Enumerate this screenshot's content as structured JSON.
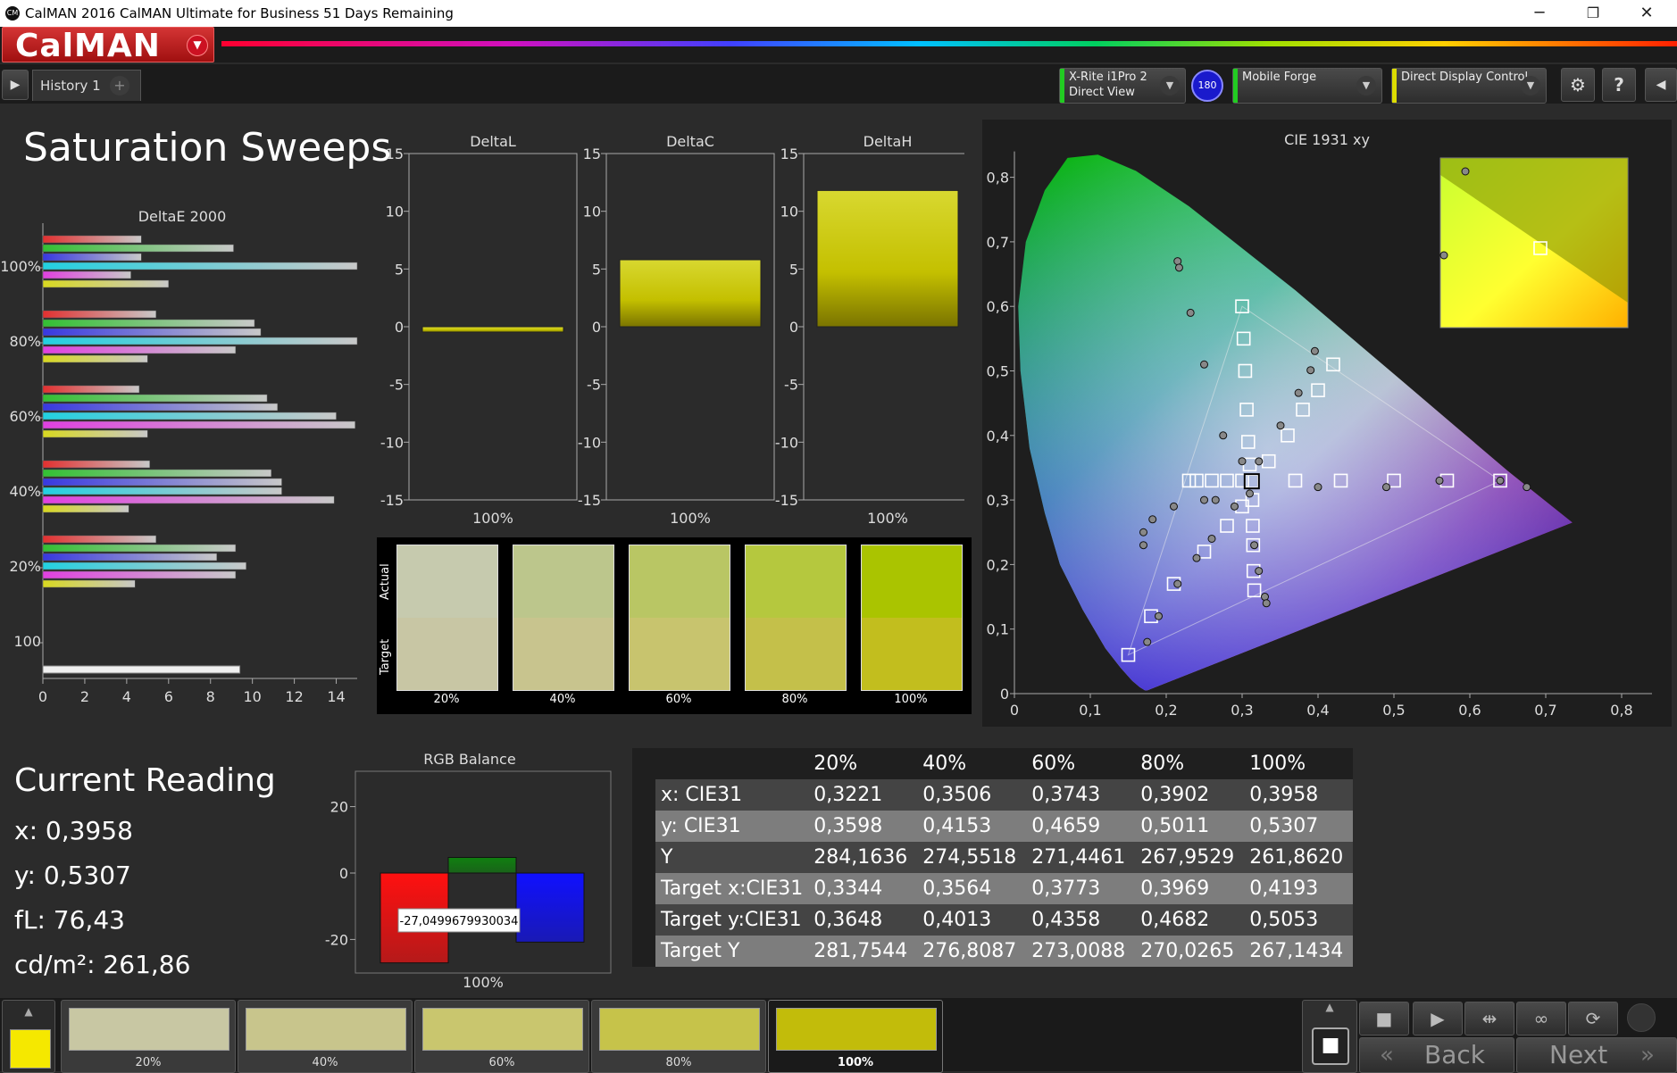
{
  "window": {
    "title": "CalMAN 2016 CalMAN Ultimate for Business 51 Days Remaining",
    "app_icon_text": "CM",
    "minimize_glyph": "─",
    "restore_glyph": "❐",
    "close_glyph": "✕"
  },
  "brand": {
    "logo_text": "CalMAN",
    "logo_arrow": "▼"
  },
  "tabs": {
    "history_label": "History 1",
    "add_glyph": "+",
    "play_glyph": "▶"
  },
  "devices": {
    "meter": {
      "line1": "X-Rite i1Pro 2",
      "line2": "Direct View",
      "stripe": "#22cc22"
    },
    "badge": "180",
    "source": {
      "line1": "Mobile Forge",
      "stripe": "#22cc22"
    },
    "display": {
      "line1": "Direct Display Control",
      "stripe": "#dddd00"
    },
    "chevron": "▼",
    "settings_glyph": "⚙",
    "help_glyph": "?",
    "collapse_glyph": "◀"
  },
  "page": {
    "title": "Saturation Sweeps"
  },
  "deltae": {
    "title": "DeltaE 2000",
    "xticks": [
      "0",
      "2",
      "4",
      "6",
      "8",
      "10",
      "12",
      "14"
    ],
    "xmax": 15,
    "groups": [
      {
        "label": "100%",
        "values": [
          4.7,
          9.1,
          4.7,
          15.0,
          4.2,
          6.0
        ]
      },
      {
        "label": "80%",
        "values": [
          5.4,
          10.1,
          10.4,
          15.0,
          9.2,
          5.0
        ]
      },
      {
        "label": "60%",
        "values": [
          4.6,
          10.7,
          11.2,
          14.0,
          14.9,
          5.0
        ]
      },
      {
        "label": "40%",
        "values": [
          5.1,
          10.9,
          11.4,
          11.4,
          13.9,
          4.1
        ]
      },
      {
        "label": "20%",
        "values": [
          5.4,
          9.2,
          8.3,
          9.7,
          9.2,
          4.4
        ]
      },
      {
        "label": "100",
        "values": [
          9.4
        ]
      }
    ],
    "bar_colors": [
      "#e23030",
      "#33c033",
      "#3838e0",
      "#22d0e0",
      "#e040e0",
      "#d8d820"
    ],
    "white_bar_color": "#f0f0f0"
  },
  "delta_charts": [
    {
      "title": "DeltaL",
      "category": "100%",
      "value": -0.3
    },
    {
      "title": "DeltaC",
      "category": "100%",
      "value": 5.8
    },
    {
      "title": "DeltaH",
      "category": "100%",
      "value": 11.8
    }
  ],
  "delta_yticks": [
    "15",
    "10",
    "5",
    "0",
    "-5",
    "-10",
    "-15"
  ],
  "swatches": {
    "actual_label": "Actual",
    "target_label": "Target",
    "items": [
      {
        "label": "20%",
        "actual": "#c6caae",
        "target": "#c8c6a4"
      },
      {
        "label": "40%",
        "actual": "#bcc68c",
        "target": "#c8c48e"
      },
      {
        "label": "60%",
        "actual": "#b9c664",
        "target": "#c8c46e"
      },
      {
        "label": "80%",
        "actual": "#b5c83e",
        "target": "#c4c04a"
      },
      {
        "label": "100%",
        "actual": "#aac400",
        "target": "#c2be1e"
      }
    ]
  },
  "cie": {
    "title": "CIE 1931 xy",
    "xticks": [
      "0",
      "0,1",
      "0,2",
      "0,3",
      "0,4",
      "0,5",
      "0,6",
      "0,7",
      "0,8"
    ],
    "yticks": [
      "0",
      "0,1",
      "0,2",
      "0,3",
      "0,4",
      "0,5",
      "0,6",
      "0,7",
      "0,8"
    ],
    "targets": [
      [
        0.15,
        0.06
      ],
      [
        0.18,
        0.12
      ],
      [
        0.21,
        0.17
      ],
      [
        0.25,
        0.22
      ],
      [
        0.28,
        0.26
      ],
      [
        0.3,
        0.29
      ],
      [
        0.3,
        0.6
      ],
      [
        0.302,
        0.55
      ],
      [
        0.304,
        0.5
      ],
      [
        0.306,
        0.44
      ],
      [
        0.308,
        0.39
      ],
      [
        0.31,
        0.355
      ],
      [
        0.64,
        0.33
      ],
      [
        0.57,
        0.33
      ],
      [
        0.5,
        0.33
      ],
      [
        0.43,
        0.33
      ],
      [
        0.37,
        0.33
      ],
      [
        0.3127,
        0.329
      ],
      [
        0.3135,
        0.3
      ],
      [
        0.314,
        0.26
      ],
      [
        0.3145,
        0.23
      ],
      [
        0.315,
        0.19
      ],
      [
        0.316,
        0.16
      ],
      [
        0.23,
        0.33
      ],
      [
        0.24,
        0.33
      ],
      [
        0.26,
        0.33
      ],
      [
        0.28,
        0.33
      ],
      [
        0.3,
        0.33
      ],
      [
        0.335,
        0.36
      ],
      [
        0.36,
        0.4
      ],
      [
        0.38,
        0.44
      ],
      [
        0.4,
        0.47
      ],
      [
        0.42,
        0.51
      ]
    ],
    "measured": [
      [
        0.175,
        0.08
      ],
      [
        0.19,
        0.12
      ],
      [
        0.215,
        0.17
      ],
      [
        0.24,
        0.21
      ],
      [
        0.26,
        0.24
      ],
      [
        0.29,
        0.29
      ],
      [
        0.215,
        0.67
      ],
      [
        0.217,
        0.66
      ],
      [
        0.232,
        0.59
      ],
      [
        0.25,
        0.51
      ],
      [
        0.275,
        0.4
      ],
      [
        0.3,
        0.36
      ],
      [
        0.675,
        0.32
      ],
      [
        0.64,
        0.33
      ],
      [
        0.56,
        0.33
      ],
      [
        0.49,
        0.32
      ],
      [
        0.4,
        0.32
      ],
      [
        0.31,
        0.31
      ],
      [
        0.316,
        0.23
      ],
      [
        0.322,
        0.19
      ],
      [
        0.33,
        0.15
      ],
      [
        0.332,
        0.14
      ],
      [
        0.17,
        0.23
      ],
      [
        0.17,
        0.25
      ],
      [
        0.182,
        0.27
      ],
      [
        0.21,
        0.29
      ],
      [
        0.25,
        0.3
      ],
      [
        0.265,
        0.3
      ],
      [
        0.3221,
        0.3598
      ],
      [
        0.3506,
        0.4153
      ],
      [
        0.3743,
        0.4659
      ],
      [
        0.3902,
        0.5011
      ],
      [
        0.3958,
        0.5307
      ]
    ]
  },
  "current_reading": {
    "title": "Current Reading",
    "x": "x: 0,3958",
    "y": "y: 0,5307",
    "fl": "fL: 76,43",
    "cd": "cd/m²: 261,86"
  },
  "rgb_balance": {
    "title": "RGB Balance",
    "category": "100%",
    "yticks": [
      "20",
      "0",
      "-20"
    ],
    "red": -27.05,
    "green": 4.7,
    "blue": -20.8,
    "tooltip": "-27,0499679930034"
  },
  "table": {
    "headers": [
      "",
      "20%",
      "40%",
      "60%",
      "80%",
      "100%"
    ],
    "rows": [
      [
        "x: CIE31",
        "0,3221",
        "0,3506",
        "0,3743",
        "0,3902",
        "0,3958"
      ],
      [
        "y: CIE31",
        "0,3598",
        "0,4153",
        "0,4659",
        "0,5011",
        "0,5307"
      ],
      [
        "Y",
        "284,1636",
        "274,5518",
        "271,4461",
        "267,9529",
        "261,8620"
      ],
      [
        "Target x:CIE31",
        "0,3344",
        "0,3564",
        "0,3773",
        "0,3969",
        "0,4193"
      ],
      [
        "Target y:CIE31",
        "0,3648",
        "0,4013",
        "0,4358",
        "0,4682",
        "0,5053"
      ],
      [
        "Target Y",
        "281,7544",
        "276,8087",
        "273,0088",
        "270,0265",
        "267,1434"
      ]
    ]
  },
  "bottom": {
    "current_swatch_color": "#f5e800",
    "tiles": [
      {
        "label": "20%",
        "color": "#c8c7a3"
      },
      {
        "label": "40%",
        "color": "#c8c58c"
      },
      {
        "label": "60%",
        "color": "#c9c66e"
      },
      {
        "label": "80%",
        "color": "#c6c34a"
      },
      {
        "label": "100%",
        "color": "#c2bc0a",
        "selected": true
      }
    ],
    "up_glyph": "▲",
    "stop_glyph": "■",
    "play_glyph": "▶",
    "step_glyph": "⇹",
    "loop_glyph": "∞",
    "refresh_glyph": "⟳",
    "back_label": "Back",
    "next_label": "Next",
    "back_glyph": "«",
    "next_glyph": "»"
  }
}
